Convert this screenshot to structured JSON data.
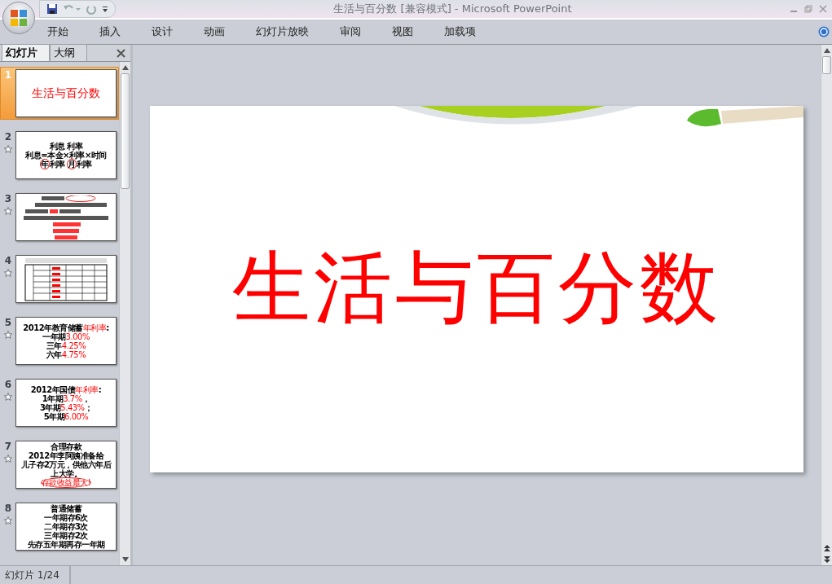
{
  "window": {
    "title": "生活与百分数 [兼容模式] - Microsoft PowerPoint"
  },
  "ribbon_tabs": [
    {
      "label": "开始",
      "selected": false
    },
    {
      "label": "插入",
      "selected": false
    },
    {
      "label": "设计",
      "selected": false
    },
    {
      "label": "动画",
      "selected": false
    },
    {
      "label": "幻灯片放映",
      "selected": false
    },
    {
      "label": "审阅",
      "selected": false
    },
    {
      "label": "视图",
      "selected": false
    },
    {
      "label": "加载项",
      "selected": false
    }
  ],
  "panel_tabs": [
    {
      "label": "幻灯片",
      "selected": true
    },
    {
      "label": "大纲",
      "selected": false
    }
  ],
  "slides": [
    {
      "number": "1",
      "selected": true,
      "kind": "title",
      "lines": [
        [
          {
            "text": "生活与百分数",
            "highlight": true,
            "circled": false
          }
        ]
      ]
    },
    {
      "number": "2",
      "selected": false,
      "kind": "text",
      "lines": [
        [
          {
            "text": "利息     利率",
            "highlight": false,
            "circled": false
          }
        ],
        [
          {
            "text": "利息=本金×利率×时间",
            "highlight": false,
            "circled": false
          }
        ],
        [
          {
            "text": "年",
            "highlight": false,
            "circled": true
          },
          {
            "text": "利率     ",
            "highlight": false,
            "circled": false
          },
          {
            "text": "月",
            "highlight": false,
            "circled": true
          },
          {
            "text": "利率",
            "highlight": false,
            "circled": false
          }
        ]
      ]
    },
    {
      "number": "3",
      "selected": false,
      "kind": "blurred"
    },
    {
      "number": "4",
      "selected": false,
      "kind": "table"
    },
    {
      "number": "5",
      "selected": false,
      "kind": "text",
      "lines": [
        [
          {
            "text": "2012年教育储蓄",
            "highlight": false,
            "circled": false
          },
          {
            "text": "年利率",
            "highlight": true,
            "circled": false
          },
          {
            "text": ":",
            "highlight": false,
            "circled": false
          }
        ],
        [
          {
            "text": "一年期",
            "highlight": false,
            "circled": false
          },
          {
            "text": "3.00%",
            "highlight": true,
            "circled": false
          }
        ],
        [
          {
            "text": "三年",
            "highlight": false,
            "circled": false
          },
          {
            "text": "4.25%",
            "highlight": true,
            "circled": false
          }
        ],
        [
          {
            "text": "六年",
            "highlight": false,
            "circled": false
          },
          {
            "text": "4.75%",
            "highlight": true,
            "circled": false
          }
        ]
      ]
    },
    {
      "number": "6",
      "selected": false,
      "kind": "text",
      "lines": [
        [
          {
            "text": "2012年国债",
            "highlight": false,
            "circled": false
          },
          {
            "text": "年利率",
            "highlight": true,
            "circled": false
          },
          {
            "text": ":",
            "highlight": false,
            "circled": false
          }
        ],
        [
          {
            "text": "1年期",
            "highlight": false,
            "circled": false
          },
          {
            "text": "3.7%",
            "highlight": true,
            "circled": false
          },
          {
            "text": "，",
            "highlight": false,
            "circled": false
          }
        ],
        [
          {
            "text": "3年期",
            "highlight": false,
            "circled": false
          },
          {
            "text": "5.43%",
            "highlight": true,
            "circled": false
          },
          {
            "text": "；",
            "highlight": false,
            "circled": false
          }
        ],
        [
          {
            "text": "5年期",
            "highlight": false,
            "circled": false
          },
          {
            "text": "6.00%",
            "highlight": true,
            "circled": false
          }
        ]
      ]
    },
    {
      "number": "7",
      "selected": false,
      "kind": "text",
      "lines": [
        [
          {
            "text": "合理存款",
            "highlight": false,
            "circled": false
          }
        ],
        [
          {
            "text": "2012年李阿姨准备给",
            "highlight": false,
            "circled": false
          }
        ],
        [
          {
            "text": "儿子存2万元，供他六年后",
            "highlight": false,
            "circled": false
          }
        ],
        [
          {
            "text": "上大学。",
            "highlight": false,
            "circled": false
          }
        ],
        [
          {
            "text": "存款收益最大!",
            "highlight": true,
            "circled": true
          }
        ]
      ]
    },
    {
      "number": "8",
      "selected": false,
      "kind": "text",
      "lines": [
        [
          {
            "text": "普通储蓄",
            "highlight": false,
            "circled": false
          }
        ],
        [
          {
            "text": "一年期存6次",
            "highlight": false,
            "circled": false
          }
        ],
        [
          {
            "text": "二年期存3次",
            "highlight": false,
            "circled": false
          }
        ],
        [
          {
            "text": "三年期存2次",
            "highlight": false,
            "circled": false
          }
        ],
        [
          {
            "text": "先存五年期再存一年期",
            "highlight": false,
            "circled": false
          }
        ]
      ]
    }
  ],
  "current_slide": {
    "title": "生活与百分数"
  },
  "status_bar": {
    "slide_indicator": "幻灯片 1/24"
  }
}
